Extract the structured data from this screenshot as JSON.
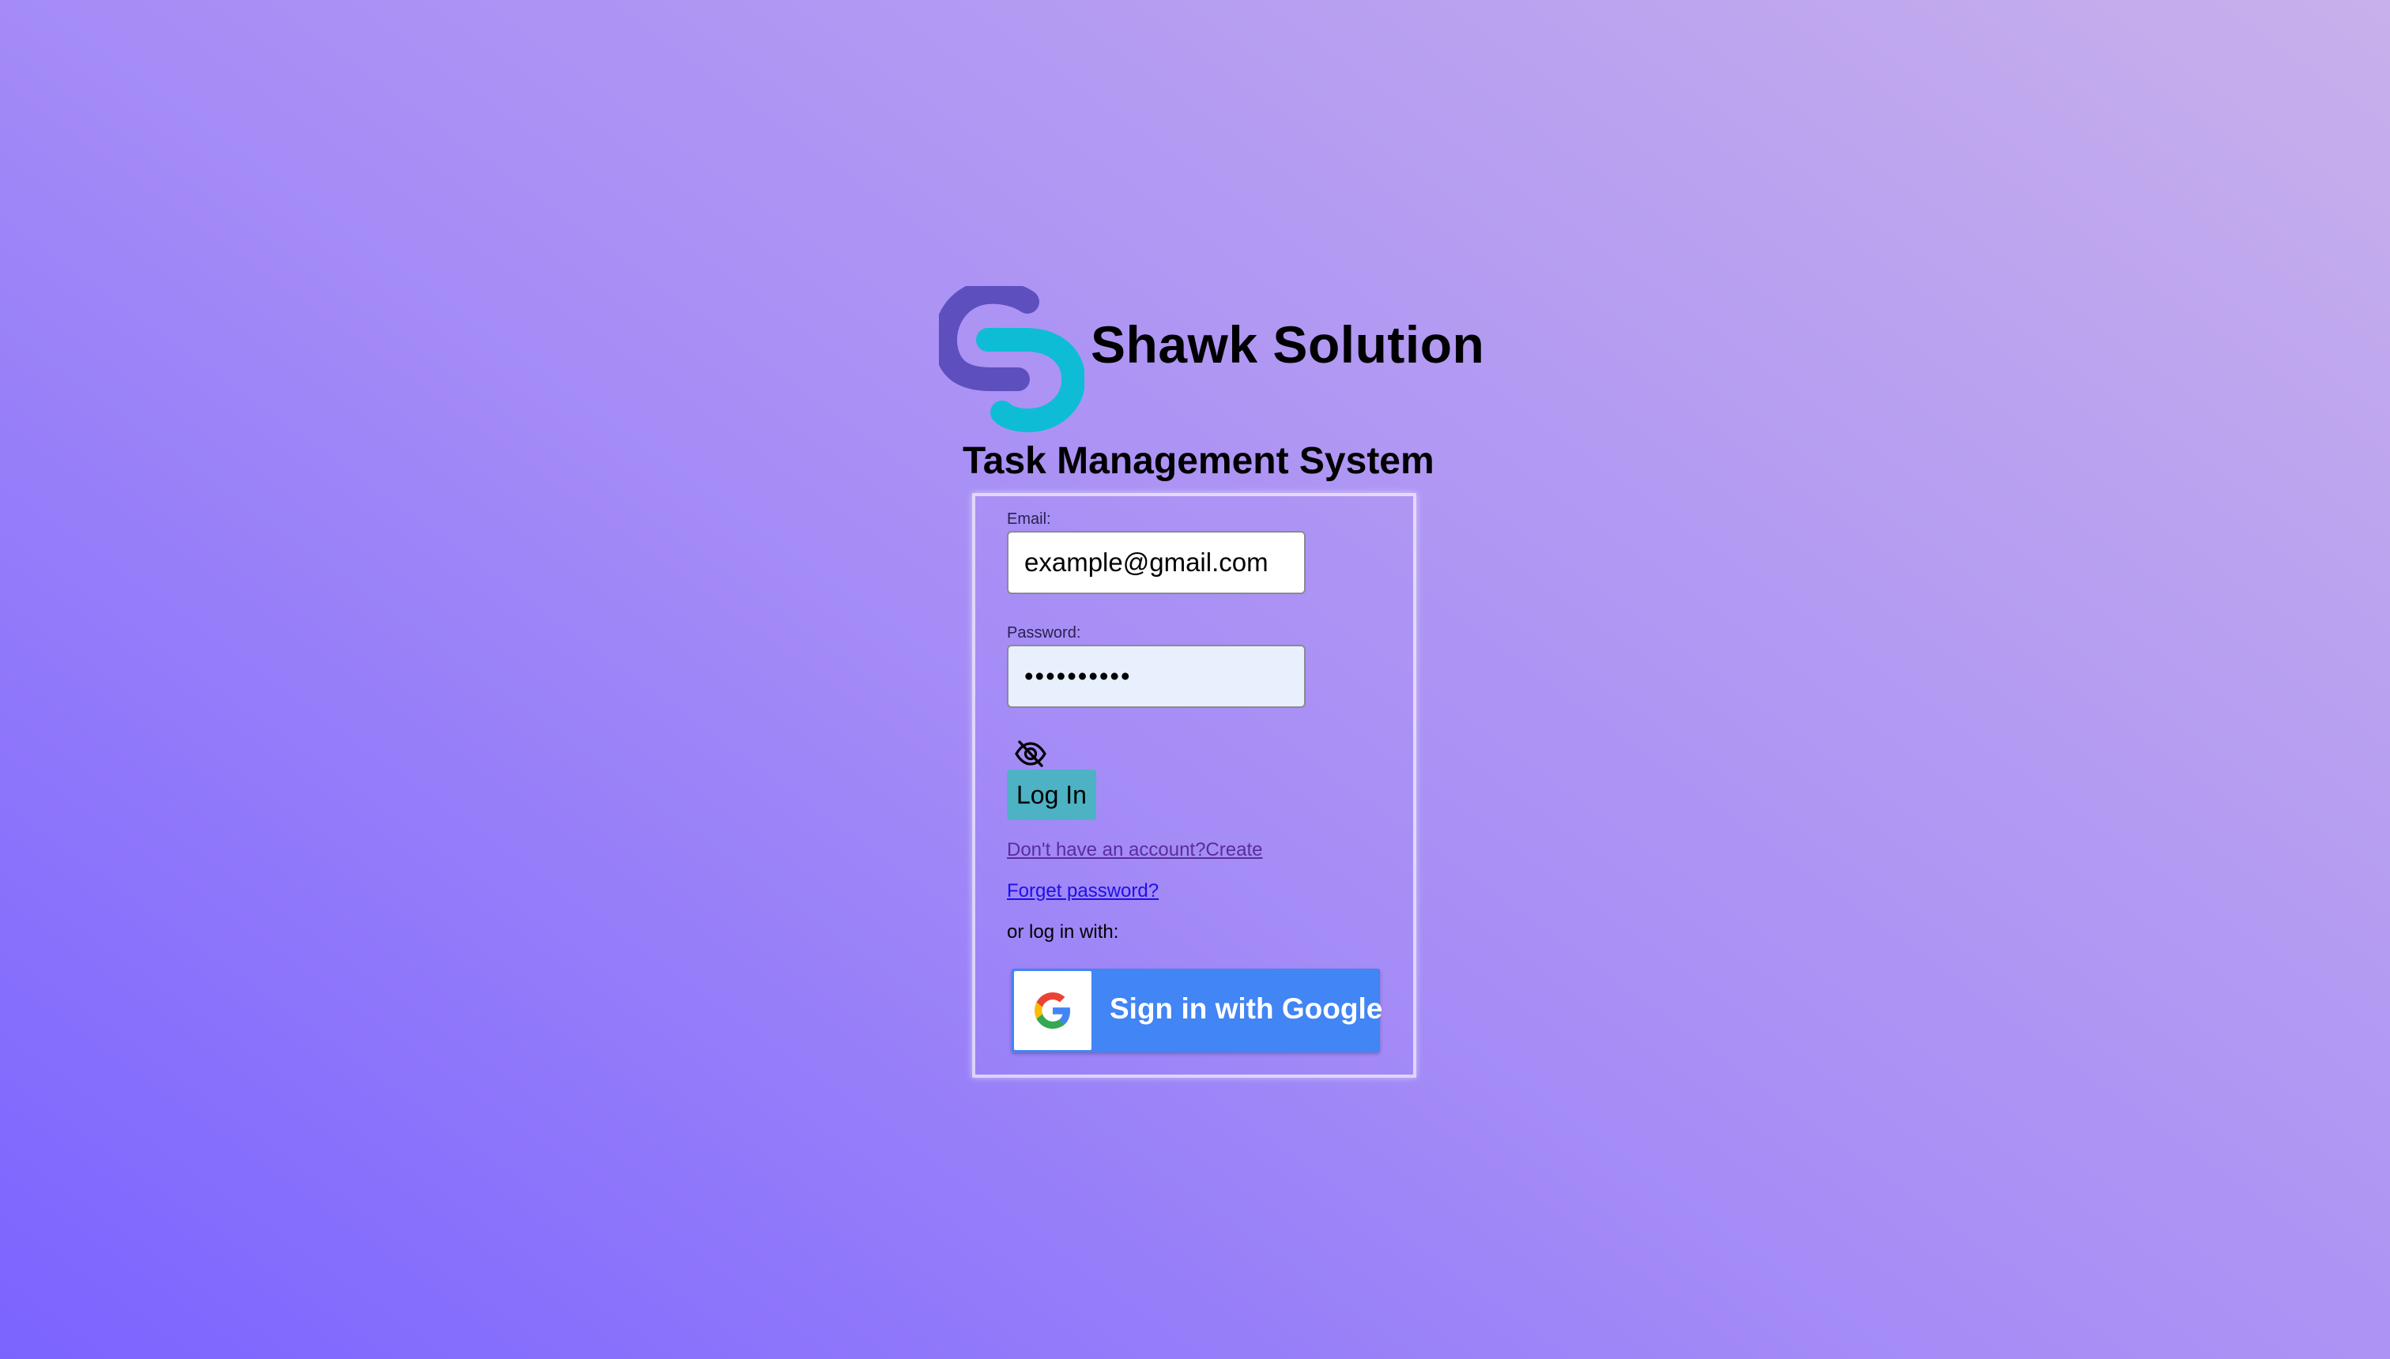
{
  "brand": {
    "name": "Shawk Solution",
    "logo_icon": "shawk-s-logo"
  },
  "system_title": "Task Management System",
  "login_form": {
    "email_label": "Email:",
    "email_value": "example@gmail.com",
    "password_label": "Password:",
    "password_value": "••••••••••",
    "toggle_icon": "eye-slash-icon",
    "login_button": "Log In",
    "create_account_link": "Don't have an account?Create",
    "forgot_password_link": "Forget password?",
    "alt_login_text": "or log in with:",
    "google_button": "Sign in with Google",
    "google_icon": "google-g-icon"
  },
  "colors": {
    "background_start": "#7b63ff",
    "background_end": "#c8b0ec",
    "logo_purple": "#5e4fbf",
    "logo_cyan": "#0fbcd5",
    "login_button_bg": "#4cb2c4",
    "google_blue": "#4285f4",
    "link_visited": "#5b2d9a",
    "link": "#1c10e8"
  }
}
